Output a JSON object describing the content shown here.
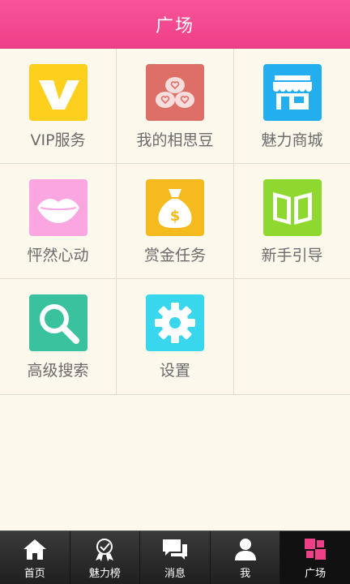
{
  "header": {
    "title": "广场"
  },
  "grid": {
    "items": [
      {
        "label": "VIP服务",
        "icon": "vip-icon",
        "color": "#fcd01c"
      },
      {
        "label": "我的相思豆",
        "icon": "beans-icon",
        "color": "#dd6f66"
      },
      {
        "label": "魅力商城",
        "icon": "store-icon",
        "color": "#23aef0"
      },
      {
        "label": "怦然心动",
        "icon": "lips-icon",
        "color": "#fba5e1"
      },
      {
        "label": "赏金任务",
        "icon": "money-bag-icon",
        "color": "#f5bb1e"
      },
      {
        "label": "新手引导",
        "icon": "book-icon",
        "color": "#8fd82f"
      },
      {
        "label": "高级搜索",
        "icon": "search-icon",
        "color": "#3ac29f"
      },
      {
        "label": "设置",
        "icon": "gear-icon",
        "color": "#39d7ee"
      }
    ]
  },
  "tabbar": {
    "items": [
      {
        "label": "首页",
        "icon": "home-icon"
      },
      {
        "label": "魅力榜",
        "icon": "trophy-icon"
      },
      {
        "label": "消息",
        "icon": "chat-icon"
      },
      {
        "label": "我",
        "icon": "user-icon"
      },
      {
        "label": "广场",
        "icon": "square-grid-icon",
        "active": true,
        "accent": "#ee3f87"
      }
    ]
  }
}
